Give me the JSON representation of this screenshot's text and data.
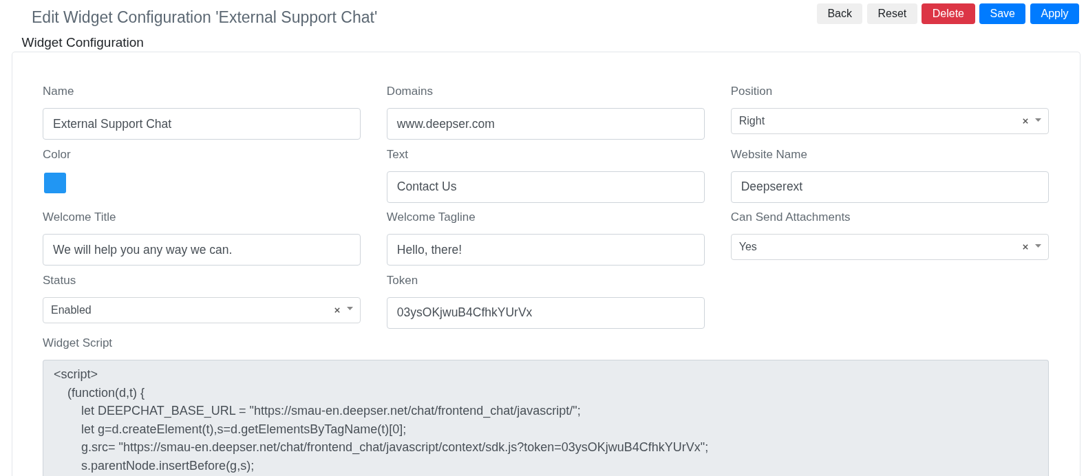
{
  "header": {
    "title": "Edit Widget Configuration 'External Support Chat'",
    "buttons": [
      {
        "label": "Back",
        "kind": "secondary"
      },
      {
        "label": "Reset",
        "kind": "secondary"
      },
      {
        "label": "Delete",
        "kind": "danger"
      },
      {
        "label": "Save",
        "kind": "primary"
      },
      {
        "label": "Apply",
        "kind": "primary"
      }
    ]
  },
  "section": {
    "title": "Widget Configuration",
    "fields": [
      {
        "label": "Name",
        "kind": "text",
        "value": "External Support Chat",
        "readonly": false
      },
      {
        "label": "Domains",
        "kind": "text",
        "value": "www.deepser.com",
        "readonly": false
      },
      {
        "label": "Position",
        "kind": "select",
        "value": "Right",
        "readonly": false
      },
      {
        "label": "Color",
        "kind": "color",
        "color": "#2196f3",
        "readonly": false
      },
      {
        "label": "Text",
        "kind": "text",
        "value": "Contact Us",
        "readonly": false
      },
      {
        "label": "Website Name",
        "kind": "text",
        "value": "Deepserext",
        "readonly": false
      },
      {
        "label": "Welcome Title",
        "kind": "text",
        "value": "We will help you any way we can.",
        "readonly": false
      },
      {
        "label": "Welcome Tagline",
        "kind": "text",
        "value": "Hello, there!",
        "readonly": false
      },
      {
        "label": "Can Send Attachments",
        "kind": "select",
        "value": "Yes",
        "readonly": false
      },
      {
        "label": "Status",
        "kind": "select",
        "value": "Enabled",
        "readonly": false
      },
      {
        "label": "Token",
        "kind": "text",
        "value": "03ysOKjwuB4CfhkYUrVx",
        "readonly": false
      },
      {
        "label": "Widget Script",
        "kind": "textarea",
        "value": "<script>\n    (function(d,t) {\n        let DEEPCHAT_BASE_URL = \"https://smau-en.deepser.net/chat/frontend_chat/javascript/\";\n        let g=d.createElement(t),s=d.getElementsByTagName(t)[0];\n        g.src= \"https://smau-en.deepser.net/chat/frontend_chat/javascript/context/sdk.js?token=03ysOKjwuB4CfhkYUrVx\";\n        s.parentNode.insertBefore(g,s);",
        "readonly": true
      }
    ]
  }
}
